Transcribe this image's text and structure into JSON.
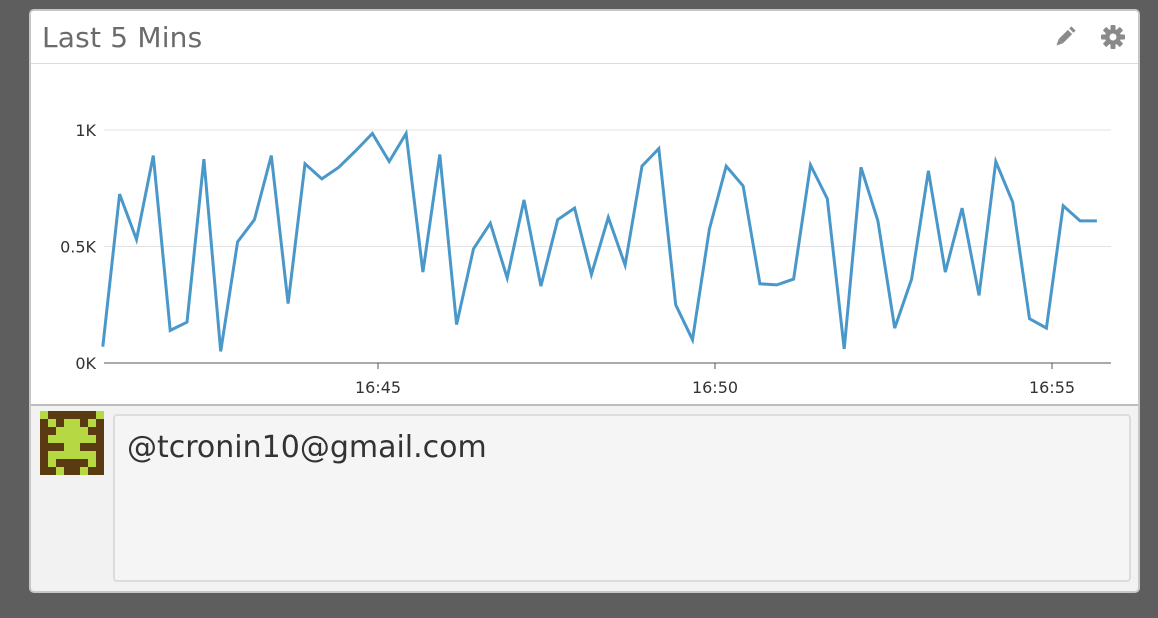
{
  "widget": {
    "title": "Last 5 Mins",
    "edit_icon": "pencil-icon",
    "settings_icon": "gear-icon"
  },
  "comment": {
    "text": "@tcronin10@gmail.com",
    "avatar_icon": "pixel-invader-avatar"
  },
  "colors": {
    "line": "#4a98c9",
    "background": "#5e5e5e",
    "avatar_bg": "#5a3a10",
    "avatar_fg": "#b6d943"
  },
  "chart_data": {
    "type": "line",
    "title": "",
    "xlabel": "",
    "ylabel": "",
    "ylim": [
      0,
      1000
    ],
    "y_ticks": [
      0,
      500,
      1000
    ],
    "y_tick_labels": [
      "0K",
      "0.5K",
      "1K"
    ],
    "x_tick_labels": [
      "16:45",
      "16:50",
      "16:55"
    ],
    "x_ticks": [
      "16:45",
      "16:50",
      "16:55"
    ],
    "grid": true,
    "series": [
      {
        "x": [
          "16:40:55",
          "16:41:10",
          "16:41:25",
          "16:41:40",
          "16:41:55",
          "16:42:10",
          "16:42:25",
          "16:42:40",
          "16:42:55",
          "16:43:10",
          "16:43:25",
          "16:43:40",
          "16:43:55",
          "16:44:10",
          "16:44:25",
          "16:44:40",
          "16:44:55",
          "16:45:10",
          "16:45:25",
          "16:45:40",
          "16:45:55",
          "16:46:10",
          "16:46:25",
          "16:46:40",
          "16:46:55",
          "16:47:10",
          "16:47:25",
          "16:47:40",
          "16:47:55",
          "16:48:10",
          "16:48:25",
          "16:48:40",
          "16:48:55",
          "16:49:10",
          "16:49:25",
          "16:49:40",
          "16:49:55",
          "16:50:10",
          "16:50:25",
          "16:50:40",
          "16:50:55",
          "16:51:10",
          "16:51:25",
          "16:51:40",
          "16:51:55",
          "16:52:10",
          "16:52:25",
          "16:52:40",
          "16:52:55",
          "16:53:10",
          "16:53:25",
          "16:53:40",
          "16:53:55",
          "16:54:10",
          "16:54:25",
          "16:54:40",
          "16:54:55",
          "16:55:10",
          "16:55:25",
          "16:55:40"
        ],
        "values": [
          70,
          725,
          530,
          890,
          140,
          175,
          875,
          50,
          520,
          615,
          890,
          255,
          855,
          790,
          840,
          910,
          985,
          865,
          985,
          390,
          895,
          165,
          490,
          600,
          365,
          700,
          330,
          615,
          665,
          380,
          625,
          420,
          845,
          920,
          250,
          100,
          575,
          845,
          760,
          340,
          335,
          360,
          850,
          705,
          60,
          840,
          610,
          150,
          360,
          825,
          390,
          665,
          290,
          865,
          690,
          190,
          150,
          675,
          610,
          610
        ]
      }
    ]
  }
}
